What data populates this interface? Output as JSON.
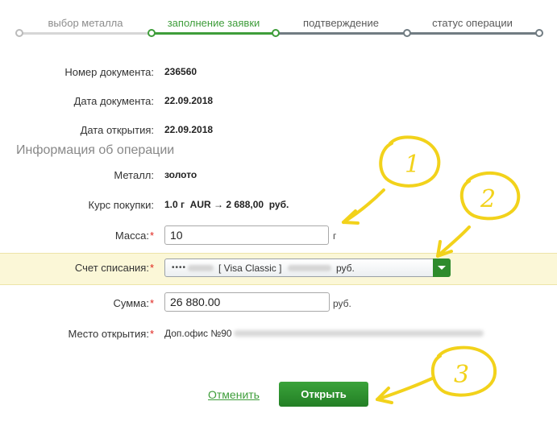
{
  "stepper": {
    "steps": [
      {
        "label": "выбор металла"
      },
      {
        "label": "заполнение заявки"
      },
      {
        "label": "подтверждение"
      },
      {
        "label": "статус операции"
      }
    ]
  },
  "document": {
    "number_label": "Номер документа:",
    "number_value": "236560",
    "date_label": "Дата документа:",
    "date_value": "22.09.2018",
    "open_date_label": "Дата открытия:",
    "open_date_value": "22.09.2018"
  },
  "operation": {
    "section_title": "Информация об операции",
    "metal_label": "Металл:",
    "metal_value": "золото",
    "rate_label": "Курс покупки:",
    "rate_value": "1.0 г  AUR → 2 688,00  руб.",
    "mass_label": "Масса:",
    "mass_value": "10",
    "mass_unit": "г",
    "account_label": "Счет списания:",
    "account_mask": "••••",
    "account_card": "[ Visa Classic ]",
    "account_currency": "руб.",
    "sum_label": "Сумма:",
    "sum_value": "26 880.00",
    "sum_unit": "руб.",
    "place_label": "Место открытия:",
    "place_value": "Доп.офис №90",
    "required_mark": "*"
  },
  "actions": {
    "cancel_label": "Отменить",
    "submit_label": "Открыть"
  },
  "annotations": {
    "one": "1",
    "two": "2",
    "three": "3",
    "color": "#f2d21b"
  }
}
